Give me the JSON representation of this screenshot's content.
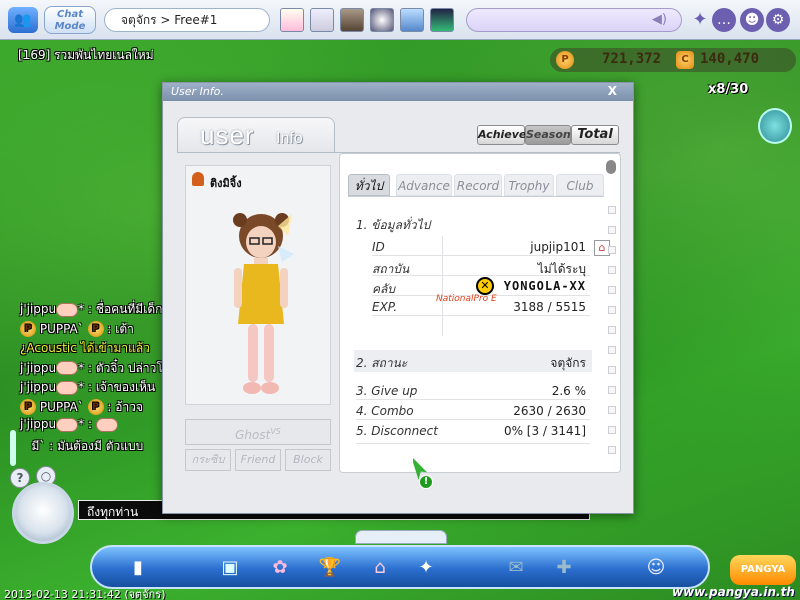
{
  "topbar": {
    "chat_mode_label": "Chat Mode",
    "channel_name": "จตุจักร > Free#1"
  },
  "notice_text": "[169] รวมพันไทยเนลใหม่",
  "currency": {
    "pang_icon": "P",
    "pang_value": "721,372",
    "cookie_icon": "C",
    "cookie_value": "140,470"
  },
  "player_count": "x8/30",
  "chat": {
    "lines": [
      {
        "name": "j'jippu",
        "text": "* : ชื่อคนที่มีเด็ก",
        "color": "#ffffff"
      },
      {
        "name": "PUPPA`",
        "text": ": เต้า",
        "color": "#ffffff"
      },
      {
        "name": "",
        "text": "¿Acoustic ได้เข้ามาแล้ว",
        "color": "#f3ea3a"
      },
      {
        "name": "j'jippu",
        "text": "* : ตัวจิ๋ว ปล่าวโ",
        "color": "#ffffff"
      },
      {
        "name": "j'jippu",
        "text": "* : เจ้าของเห็น",
        "color": "#ffffff"
      },
      {
        "name": "PUPPA`",
        "text": ": อ้าวจ",
        "color": "#ffffff"
      },
      {
        "name": "j'jippu",
        "text": "* :",
        "color": "#ffffff"
      },
      {
        "name": "",
        "text": "มี` : มันต้องมี ตัวแบบ",
        "color": "#ffffff"
      }
    ],
    "input_target": "ถึงทุกท่าน"
  },
  "footer": {
    "timestamp": "2013-02-13 21:31:42 (จตุจักร)",
    "site_url": "www.pangya.in.th",
    "logo_text": "PANGYA"
  },
  "dialog": {
    "title": "User Info.",
    "close_label": "X",
    "header_big": "user",
    "header_small": "Info",
    "mode_buttons": {
      "achieve": "Achieve.",
      "season": "Season",
      "total": "Total"
    },
    "nickname": "ติงมิจิ้ง",
    "ghost_label": "Ghost",
    "ghost_sup": "VS",
    "bottom_tabs": {
      "board": "กระซิบ",
      "friend": "Friend",
      "block": "Block"
    },
    "tabs": {
      "general": "ทั่วไป",
      "advance": "Advance",
      "record": "Record",
      "trophy": "Trophy",
      "club": "Club"
    },
    "section1": "1. ข้อมูลทั่วไป",
    "fields": {
      "id_label": "ID",
      "id_value": "jupjip101",
      "status_label": "สถาบัน",
      "status_value": "ไม่ได้ระบุ",
      "club_label": "คลับ",
      "club_value": "YONGOLA-XX",
      "club_tag": "NationalPro E",
      "exp_label": "EXP.",
      "exp_value": "3188 / 5515"
    },
    "section2_label": "2. สถานะ",
    "section2_value": "จตุจักร",
    "stats": {
      "giveup_label": "3. Give up",
      "giveup_value": "2.6 %",
      "combo_label": "4. Combo",
      "combo_value": "2630 / 2630",
      "disconnect_label": "5. Disconnect",
      "disconnect_value": "0% [3 / 3141]"
    }
  },
  "colors": {
    "dialog_bg": "#e9eaed",
    "title_bar": "#8b9db6",
    "bottom_bar": "#2b6fcf"
  }
}
